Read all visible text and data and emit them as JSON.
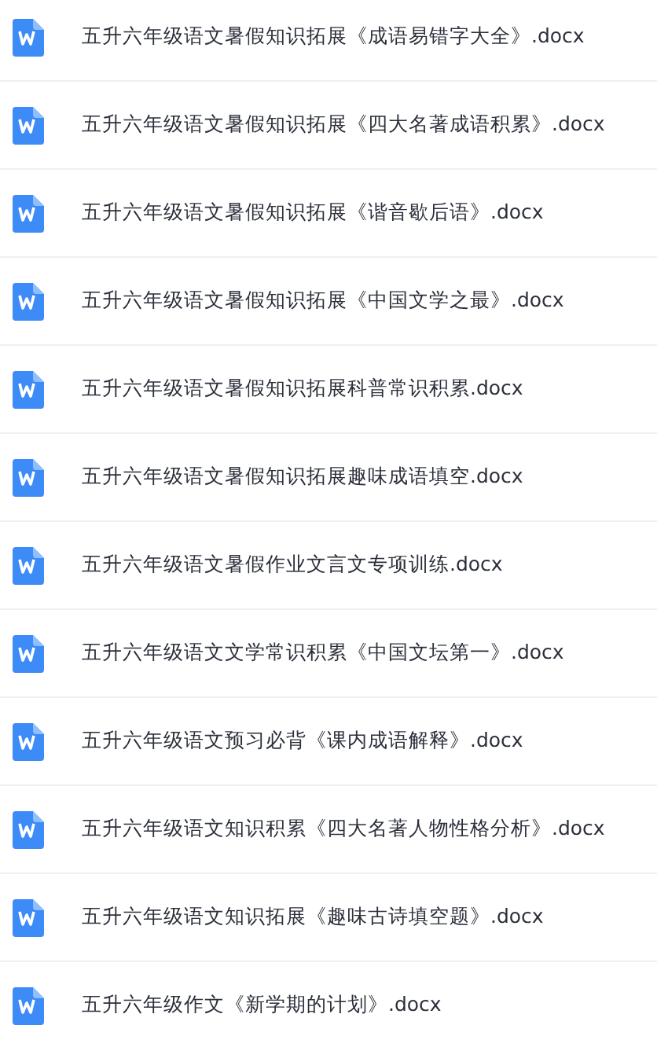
{
  "files": [
    {
      "name": "五升六年级语文暑假知识拓展《成语易错字大全》.docx"
    },
    {
      "name": "五升六年级语文暑假知识拓展《四大名著成语积累》.docx"
    },
    {
      "name": "五升六年级语文暑假知识拓展《谐音歇后语》.docx"
    },
    {
      "name": "五升六年级语文暑假知识拓展《中国文学之最》.docx"
    },
    {
      "name": "五升六年级语文暑假知识拓展科普常识积累.docx"
    },
    {
      "name": "五升六年级语文暑假知识拓展趣味成语填空.docx"
    },
    {
      "name": "五升六年级语文暑假作业文言文专项训练.docx"
    },
    {
      "name": "五升六年级语文文学常识积累《中国文坛第一》.docx"
    },
    {
      "name": "五升六年级语文预习必背《课内成语解释》.docx"
    },
    {
      "name": "五升六年级语文知识积累《四大名著人物性格分析》.docx"
    },
    {
      "name": "五升六年级语文知识拓展《趣味古诗填空题》.docx"
    },
    {
      "name": "五升六年级作文《新学期的计划》.docx"
    }
  ]
}
